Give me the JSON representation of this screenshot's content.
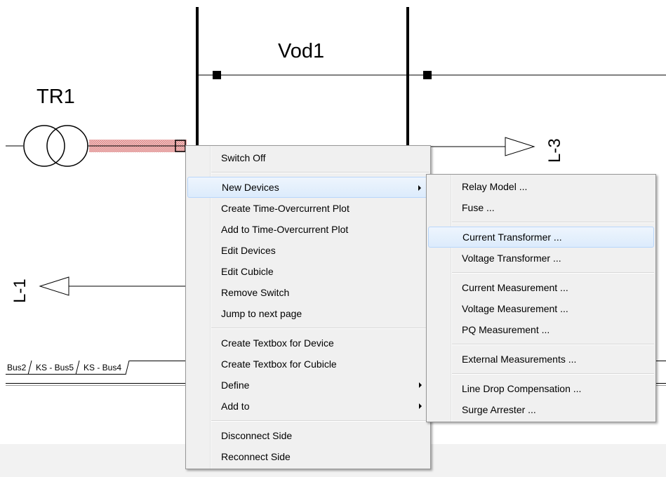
{
  "diagram": {
    "bus_label": "Vod1",
    "transformer_label": "TR1",
    "line_right_label": "L-3",
    "line_left_label": "L-1"
  },
  "tabs": [
    "Bus2",
    "KS - Bus5",
    "KS - Bus4"
  ],
  "context_menu": {
    "items": [
      {
        "label": "Switch Off"
      },
      {
        "label": "New Devices"
      },
      {
        "label": "Create Time-Overcurrent Plot"
      },
      {
        "label": "Add to Time-Overcurrent Plot"
      },
      {
        "label": "Edit Devices"
      },
      {
        "label": "Edit Cubicle"
      },
      {
        "label": "Remove Switch"
      },
      {
        "label": "Jump to next page"
      },
      {
        "label": "Create Textbox for Device"
      },
      {
        "label": "Create Textbox for Cubicle"
      },
      {
        "label": "Define"
      },
      {
        "label": "Add to"
      },
      {
        "label": "Disconnect Side"
      },
      {
        "label": "Reconnect Side"
      }
    ]
  },
  "submenu_new_devices": {
    "items": [
      {
        "label": "Relay Model ..."
      },
      {
        "label": "Fuse ..."
      },
      {
        "label": "Current Transformer ..."
      },
      {
        "label": "Voltage Transformer ..."
      },
      {
        "label": "Current Measurement ..."
      },
      {
        "label": "Voltage Measurement ..."
      },
      {
        "label": "PQ Measurement ..."
      },
      {
        "label": "External Measurements ..."
      },
      {
        "label": "Line Drop Compensation ..."
      },
      {
        "label": "Surge Arrester ..."
      }
    ]
  },
  "colors": {
    "menu_highlight": "#dcebfc",
    "menu_highlight_border": "#b8d6fb",
    "selected_line": "#e8a0a0"
  }
}
